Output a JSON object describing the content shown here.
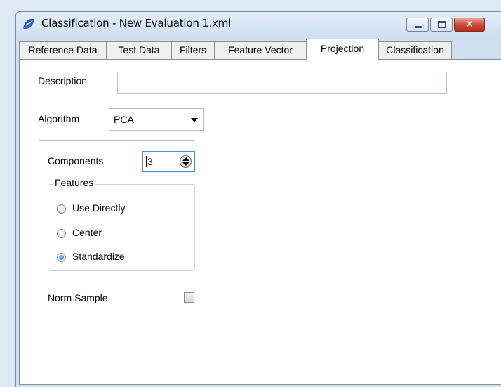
{
  "window": {
    "title": "Classification - New Evaluation 1.xml",
    "icon": "app-logo-icon",
    "controls": {
      "minimize": "minimize-icon",
      "maximize": "maximize-icon",
      "close_glyph": "✕"
    }
  },
  "tabs": [
    {
      "label": "Reference Data",
      "active": false
    },
    {
      "label": "Test Data",
      "active": false
    },
    {
      "label": "Filters",
      "active": false
    },
    {
      "label": "Feature Vector",
      "active": false
    },
    {
      "label": "Projection",
      "active": true
    },
    {
      "label": "Classification",
      "active": false
    }
  ],
  "form": {
    "description_label": "Description",
    "description_value": "",
    "algorithm_label": "Algorithm",
    "algorithm_value": "PCA",
    "components_label": "Components",
    "components_value": "3",
    "features_legend": "Features",
    "features_options": [
      {
        "label": "Use Directly",
        "checked": false
      },
      {
        "label": "Center",
        "checked": false
      },
      {
        "label": "Standardize",
        "checked": true
      }
    ],
    "norm_sample_label": "Norm Sample",
    "norm_sample_checked": false
  },
  "colors": {
    "window_frame": "#cfdff0",
    "close_button": "#c74632",
    "focus_border": "#4d8fd6"
  }
}
